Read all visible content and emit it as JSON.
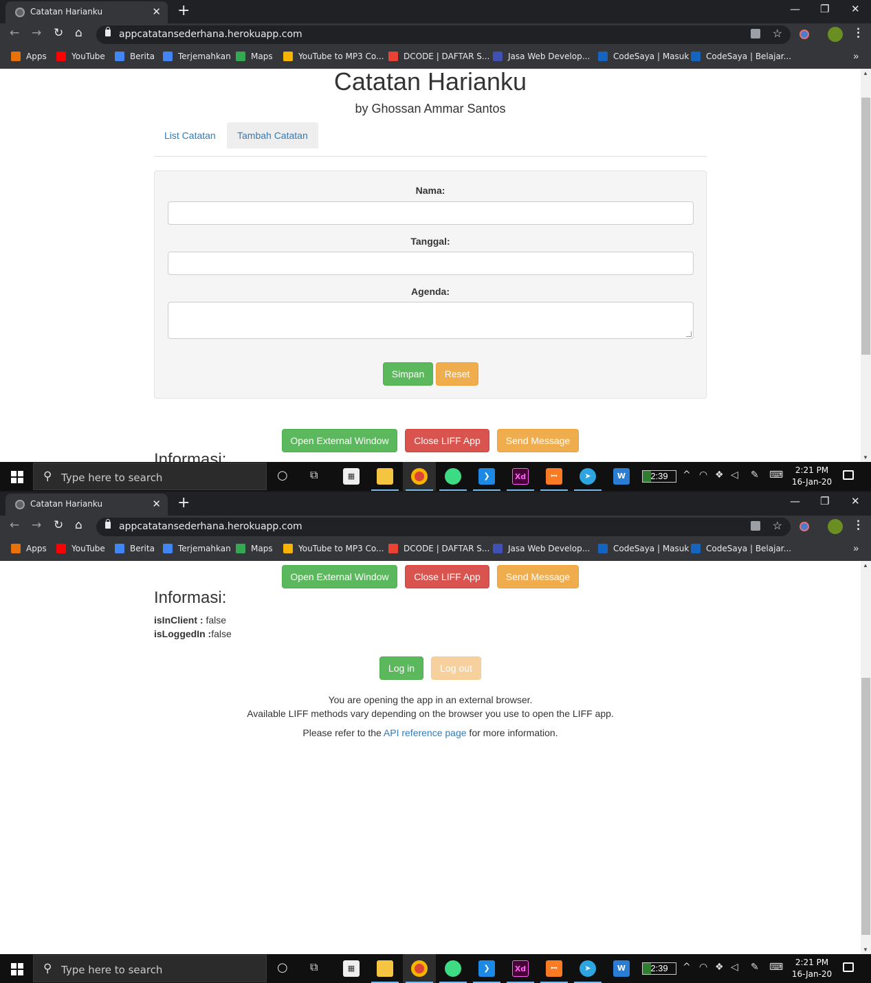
{
  "browser": {
    "tab_title": "Catatan Harianku",
    "tab_close": "✕",
    "new_tab": "+",
    "url": "appcatatansederhana.herokuapp.com",
    "bookmarks": [
      {
        "label": "Apps",
        "color": "#e8710a"
      },
      {
        "label": "YouTube",
        "color": "#ff0000"
      },
      {
        "label": "Berita",
        "color": "#4285f4"
      },
      {
        "label": "Terjemahkan",
        "color": "#4285f4"
      },
      {
        "label": "Maps",
        "color": "#34a853"
      },
      {
        "label": "YouTube to MP3 Co...",
        "color": "#f4b400"
      },
      {
        "label": "DCODE | DAFTAR S...",
        "color": "#ea4335"
      },
      {
        "label": "Jasa Web Develop...",
        "color": "#3f51b5"
      },
      {
        "label": "CodeSaya | Masuk",
        "color": "#1565c0"
      },
      {
        "label": "CodeSaya | Belajar...",
        "color": "#1565c0"
      }
    ],
    "bookmarks_more": "»"
  },
  "page": {
    "title": "Catatan Harianku",
    "subtitle": "by Ghossan Ammar Santos",
    "tabs": [
      {
        "label": "List Catatan",
        "active": false
      },
      {
        "label": "Tambah Catatan",
        "active": true
      }
    ],
    "form": {
      "nama_label": "Nama:",
      "tanggal_label": "Tanggal:",
      "agenda_label": "Agenda:",
      "save_label": "Simpan",
      "reset_label": "Reset"
    },
    "liff_buttons": {
      "open_external": "Open External Window",
      "close_liff": "Close LIFF App",
      "send_message": "Send Message"
    },
    "info": {
      "heading": "Informasi:",
      "is_in_client_label": "isInClient :",
      "is_in_client_value": " false",
      "is_logged_in_label": "isLoggedIn :",
      "is_logged_in_value": "false",
      "login_label": "Log in",
      "logout_label": "Log out",
      "note_line1": "You are opening the app in an external browser.",
      "note_line2": "Available LIFF methods vary depending on the browser you use to open the LIFF app.",
      "note_line3_pre": "Please refer to the ",
      "note_line3_link": "API reference page",
      "note_line3_post": " for more information."
    }
  },
  "taskbar": {
    "search_placeholder": "Type here to search",
    "battery_text": "2:39",
    "time": "2:21 PM",
    "date": "16-Jan-20"
  }
}
